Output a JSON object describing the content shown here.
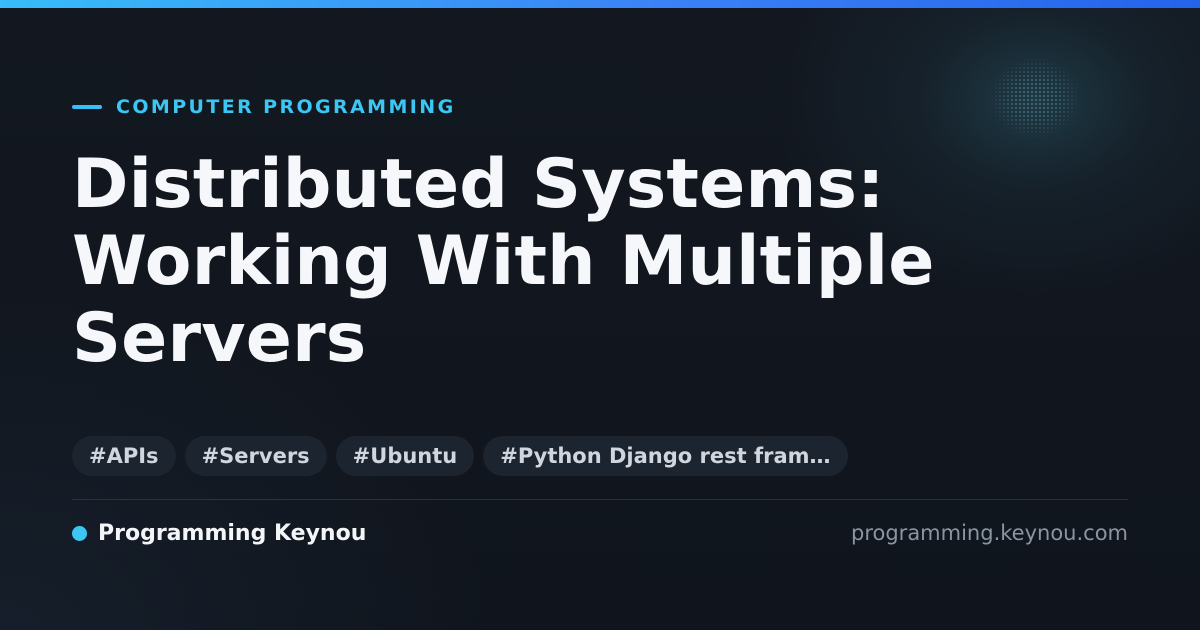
{
  "colors": {
    "accent": "#38bdf8",
    "background": "#121720",
    "tag_background": "#1c2430",
    "title": "#f5f7fa",
    "muted": "#8a94a3"
  },
  "header": {
    "category": "COMPUTER PROGRAMMING",
    "title_lines": [
      "Distributed Systems:",
      "Working With Multiple",
      "Servers"
    ]
  },
  "tags": [
    "#APIs",
    "#Servers",
    "#Ubuntu",
    "#Python Django rest fram…"
  ],
  "footer": {
    "author": "Programming Keynou",
    "site": "programming.keynou.com"
  }
}
